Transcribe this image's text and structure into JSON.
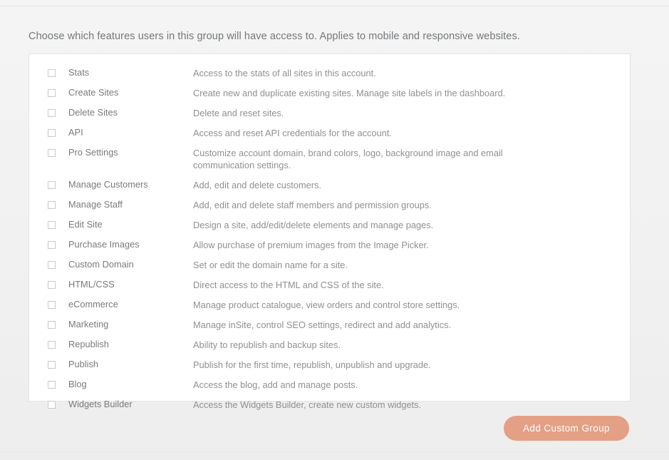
{
  "heading": "Choose which features users in this group will have access to. Applies to mobile and responsive websites.",
  "permissions": [
    {
      "label": "Stats",
      "description": "Access to the stats of all sites in this account.",
      "checked": false
    },
    {
      "label": "Create Sites",
      "description": "Create new and duplicate existing sites. Manage site labels in the dashboard.",
      "checked": false
    },
    {
      "label": "Delete Sites",
      "description": "Delete and reset sites.",
      "checked": false
    },
    {
      "label": "API",
      "description": "Access and reset API credentials for the account.",
      "checked": false
    },
    {
      "label": "Pro Settings",
      "description": "Customize account domain, brand colors, logo, background image and email communication settings.",
      "checked": false
    },
    {
      "label": "Manage Customers",
      "description": "Add, edit and delete customers.",
      "checked": false
    },
    {
      "label": "Manage Staff",
      "description": "Add, edit and delete staff members and permission groups.",
      "checked": false
    },
    {
      "label": "Edit Site",
      "description": "Design a site, add/edit/delete elements and manage pages.",
      "checked": false
    },
    {
      "label": "Purchase Images",
      "description": "Allow purchase of premium images from the Image Picker.",
      "checked": false
    },
    {
      "label": "Custom Domain",
      "description": "Set or edit the domain name for a site.",
      "checked": false
    },
    {
      "label": "HTML/CSS",
      "description": "Direct access to the HTML and CSS of the site.",
      "checked": false
    },
    {
      "label": "eCommerce",
      "description": "Manage product catalogue, view orders and control store settings.",
      "checked": false
    },
    {
      "label": "Marketing",
      "description": "Manage inSite, control SEO settings, redirect and add analytics.",
      "checked": false
    },
    {
      "label": "Republish",
      "description": "Ability to republish and backup sites.",
      "checked": false
    },
    {
      "label": "Publish",
      "description": "Publish for the first time, republish, unpublish and upgrade.",
      "checked": false
    },
    {
      "label": "Blog",
      "description": "Access the blog, add and manage posts.",
      "checked": false
    },
    {
      "label": "Widgets Builder",
      "description": "Access the Widgets Builder, create new custom widgets.",
      "checked": false
    }
  ],
  "footer": {
    "add_custom_group_label": "Add Custom Group"
  },
  "colors": {
    "accent": "#e4a084",
    "page_background": "#f2f2f2",
    "card_background": "#ffffff",
    "card_border": "#e4e4e4",
    "heading_text": "#74787b",
    "label_text": "#7b7b7b",
    "description_text": "#909090",
    "checkbox_border": "#c9c9c9"
  }
}
